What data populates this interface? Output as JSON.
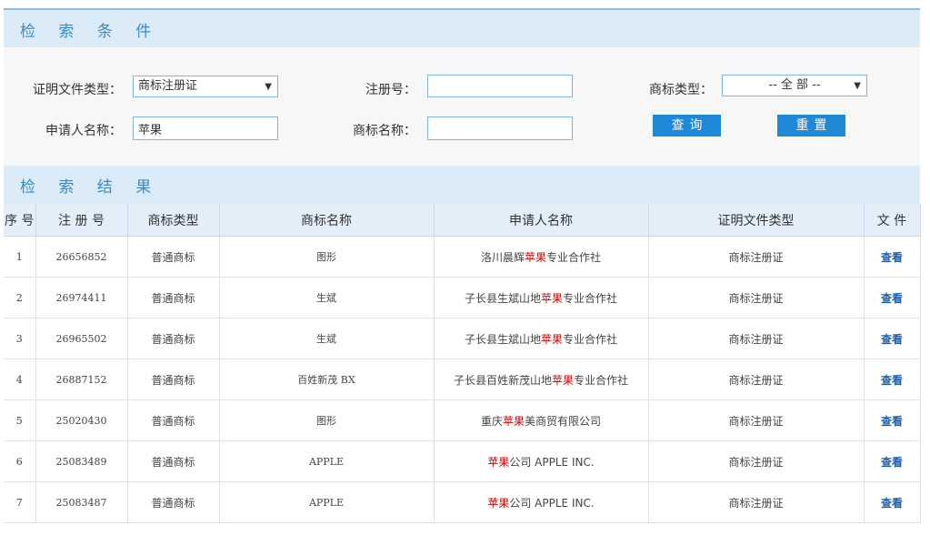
{
  "search_section": {
    "title": "检 索 条 件"
  },
  "form": {
    "doc_type": {
      "label": "证明文件类型：",
      "value": "商标注册证"
    },
    "reg_no": {
      "label": "注册号：",
      "value": ""
    },
    "tm_type": {
      "label": "商标类型：",
      "value": "-- 全 部 --"
    },
    "applicant": {
      "label": "申请人名称：",
      "value": "苹果"
    },
    "tm_name": {
      "label": "商标名称：",
      "value": ""
    },
    "query_label": "查询",
    "reset_label": "重置"
  },
  "results_section": {
    "title": "检 索 结 果"
  },
  "table": {
    "headers": [
      "序 号",
      "注 册 号",
      "商标类型",
      "商标名称",
      "申请人名称",
      "证明文件类型",
      "文 件"
    ],
    "highlight_term": "苹果",
    "rows": [
      {
        "no": "1",
        "reg": "26656852",
        "type": "普通商标",
        "name": "图形",
        "applicant": "洛川晨辉苹果专业合作社",
        "doc": "商标注册证",
        "file": "查看"
      },
      {
        "no": "2",
        "reg": "26974411",
        "type": "普通商标",
        "name": "生斌",
        "applicant": "子长县生斌山地苹果专业合作社",
        "doc": "商标注册证",
        "file": "查看"
      },
      {
        "no": "3",
        "reg": "26965502",
        "type": "普通商标",
        "name": "生斌",
        "applicant": "子长县生斌山地苹果专业合作社",
        "doc": "商标注册证",
        "file": "查看"
      },
      {
        "no": "4",
        "reg": "26887152",
        "type": "普通商标",
        "name": "百姓新茂 BX",
        "applicant": "子长县百姓新茂山地苹果专业合作社",
        "doc": "商标注册证",
        "file": "查看"
      },
      {
        "no": "5",
        "reg": "25020430",
        "type": "普通商标",
        "name": "图形",
        "applicant": "重庆苹果美商贸有限公司",
        "doc": "商标注册证",
        "file": "查看"
      },
      {
        "no": "6",
        "reg": "25083489",
        "type": "普通商标",
        "name": "APPLE",
        "applicant": "苹果公司 APPLE INC.",
        "doc": "商标注册证",
        "file": "查看"
      },
      {
        "no": "7",
        "reg": "25083487",
        "type": "普通商标",
        "name": "APPLE",
        "applicant": "苹果公司 APPLE INC.",
        "doc": "商标注册证",
        "file": "查看"
      }
    ]
  }
}
